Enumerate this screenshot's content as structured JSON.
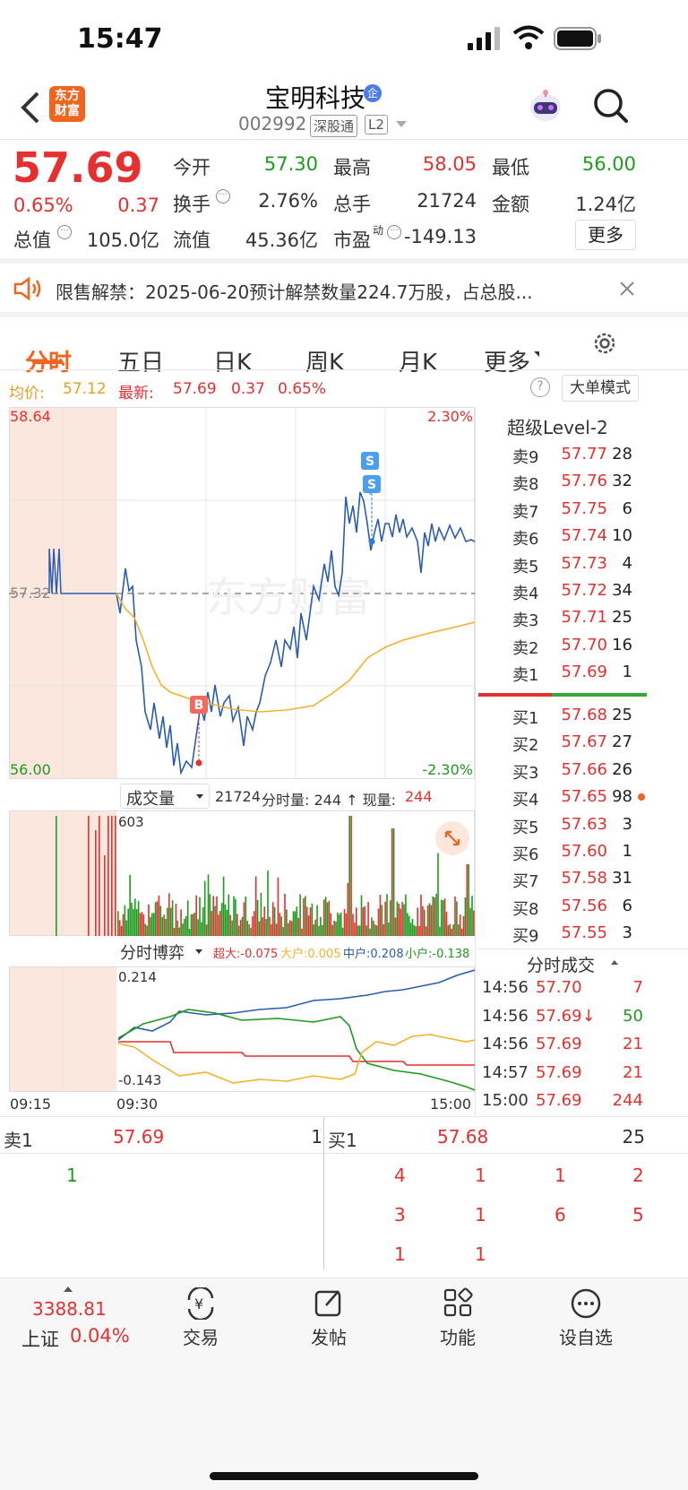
{
  "status_bar": {
    "time": "15:47"
  },
  "header": {
    "logo_line1": "东方",
    "logo_line2": "财富",
    "title": "宝明科技",
    "badge": "企",
    "code": "002992",
    "exchange": "深股通",
    "level": "L2"
  },
  "quote": {
    "price": "57.69",
    "pct": "0.65%",
    "chg": "0.37",
    "fields": [
      {
        "label": "今开",
        "value": "57.30"
      },
      {
        "label": "最高",
        "value": "58.05"
      },
      {
        "label": "最低",
        "value": "56.00"
      },
      {
        "label": "换手",
        "value": "2.76%"
      },
      {
        "label": "总手",
        "value": "21724"
      },
      {
        "label": "金额",
        "value": "1.24亿"
      },
      {
        "label": "总值",
        "value": "105.0亿"
      },
      {
        "label": "流值",
        "value": "45.36亿"
      },
      {
        "label": "市盈",
        "sup": "动",
        "value": "-149.13"
      }
    ],
    "more": "更多"
  },
  "notice": {
    "text": "限售解禁：2025-06-20预计解禁数量224.7万股，占总股..."
  },
  "tabs": [
    "分时",
    "五日",
    "日K",
    "周K",
    "月K",
    "更多"
  ],
  "chart": {
    "avg_label": "均价:",
    "avg": "57.12",
    "last_label": "最新:",
    "last": "57.69",
    "chg": "0.37",
    "pct": "0.65%",
    "big_order": "大单模式",
    "y_top": "58.64",
    "y_mid": "57.32",
    "y_bot": "56.00",
    "pct_top": "2.30%",
    "pct_bot": "-2.30%",
    "vol_selector": "成交量",
    "vol_info_total": "21724",
    "vol_info_label": "分时量: 244 ↑ 现量:",
    "vol_info_now": "244",
    "vol_max": "603",
    "game_selector": "分时博弈",
    "game_super": "超大:-0.075",
    "game_big": "大户:0.005",
    "game_mid": "中户:0.208",
    "game_small": "小户:-0.138",
    "game_top": "0.214",
    "game_bot": "-0.143",
    "time_start": "09:15",
    "time_open": "09:30",
    "time_end": "15:00",
    "marker_b": "B",
    "marker_s": "S"
  },
  "level2": {
    "title": "超级Level-2",
    "asks": [
      [
        "卖9",
        "57.77",
        "28"
      ],
      [
        "卖8",
        "57.76",
        "32"
      ],
      [
        "卖7",
        "57.75",
        "6"
      ],
      [
        "卖6",
        "57.74",
        "10"
      ],
      [
        "卖5",
        "57.73",
        "4"
      ],
      [
        "卖4",
        "57.72",
        "34"
      ],
      [
        "卖3",
        "57.71",
        "25"
      ],
      [
        "卖2",
        "57.70",
        "16"
      ],
      [
        "卖1",
        "57.69",
        "1"
      ]
    ],
    "bids": [
      [
        "买1",
        "57.68",
        "25"
      ],
      [
        "买2",
        "57.67",
        "27"
      ],
      [
        "买3",
        "57.66",
        "26"
      ],
      [
        "买4",
        "57.65",
        "98"
      ],
      [
        "买5",
        "57.63",
        "3"
      ],
      [
        "买6",
        "57.60",
        "1"
      ],
      [
        "买7",
        "57.58",
        "31"
      ],
      [
        "买8",
        "57.56",
        "6"
      ],
      [
        "买9",
        "57.55",
        "3"
      ]
    ],
    "trades_title": "分时成交",
    "trades": [
      [
        "14:56",
        "57.70",
        "7"
      ],
      [
        "14:56",
        "57.69↓",
        "50"
      ],
      [
        "14:56",
        "57.69",
        "21"
      ],
      [
        "14:57",
        "57.69",
        "21"
      ],
      [
        "15:00",
        "57.69",
        "244"
      ]
    ]
  },
  "queue": {
    "sell_label": "卖1",
    "sell_price": "57.69",
    "sell_qty": "1",
    "buy_label": "买1",
    "buy_price": "57.68",
    "buy_qty": "25",
    "sell_orders": [
      "1"
    ],
    "buy_orders": [
      "4",
      "1",
      "1",
      "2",
      "3",
      "1",
      "6",
      "5",
      "1",
      "1"
    ]
  },
  "bottom_nav": {
    "index_value": "3388.81",
    "index_name": "上证",
    "index_pct": "0.04%",
    "items": [
      "交易",
      "发帖",
      "功能",
      "设自选"
    ]
  },
  "colors": {
    "up": "#e5302f",
    "down": "#1d9b1d",
    "price_line": "#2a5cb3",
    "avg_line": "#f3b22c",
    "accent": "#f0641e"
  }
}
